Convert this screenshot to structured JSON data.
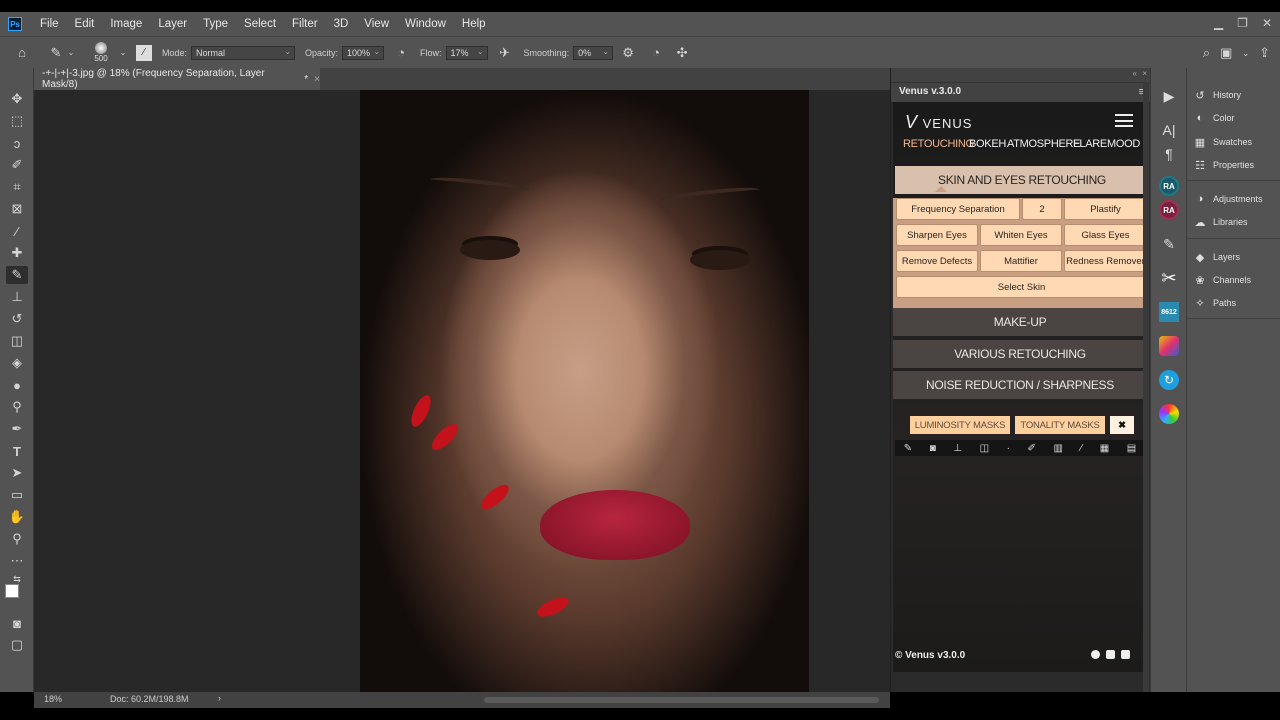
{
  "menubar": {
    "logo": "Ps",
    "items": [
      "File",
      "Edit",
      "Image",
      "Layer",
      "Type",
      "Select",
      "Filter",
      "3D",
      "View",
      "Window",
      "Help"
    ]
  },
  "options": {
    "brush_size": "500",
    "mode_label": "Mode:",
    "mode_value": "Normal",
    "opacity_label": "Opacity:",
    "opacity_value": "100%",
    "flow_label": "Flow:",
    "flow_value": "17%",
    "smoothing_label": "Smoothing:",
    "smoothing_value": "0%"
  },
  "document": {
    "tab_title": "-+-|-+|-3.jpg @ 18% (Frequency Separation, Layer Mask/8)",
    "tab_mark": "*"
  },
  "status": {
    "zoom": "18%",
    "doc_info": "Doc: 60.2M/198.8M",
    "arrow": "›"
  },
  "venus": {
    "panel_title": "Venus v.3.0.0",
    "logo_text": "VENUS",
    "nav": [
      "RETOUCHING",
      "BOKEH",
      "ATMOSPHERE",
      "FLARE",
      "MOOD"
    ],
    "skin_section": "SKIN AND EYES RETOUCHING",
    "buttons": {
      "frequency_separation": "Frequency Separation",
      "two": "2",
      "plastify": "Plastify",
      "sharpen_eyes": "Sharpen Eyes",
      "whiten_eyes": "Whiten Eyes",
      "glass_eyes": "Glass Eyes",
      "remove_defects": "Remove Defects",
      "mattifier": "Mattifier",
      "redness_remover": "Redness Remover",
      "select_skin": "Select Skin"
    },
    "sections": [
      "MAKE-UP",
      "VARIOUS RETOUCHING",
      "NOISE REDUCTION / SHARPNESS"
    ],
    "luminosity_masks": "LUMINOSITY MASKS",
    "tonality_masks": "TONALITY MASKS",
    "close_symbol": "✖",
    "footer": "© Venus v3.0.0"
  },
  "right_panels": {
    "group1": [
      "History",
      "Color",
      "Swatches",
      "Properties"
    ],
    "group2": [
      "Adjustments",
      "Libraries"
    ],
    "group3": [
      "Layers",
      "Channels",
      "Paths"
    ]
  },
  "strip": {
    "ra1": "RA",
    "ra2": "RA",
    "badge": "8612"
  }
}
